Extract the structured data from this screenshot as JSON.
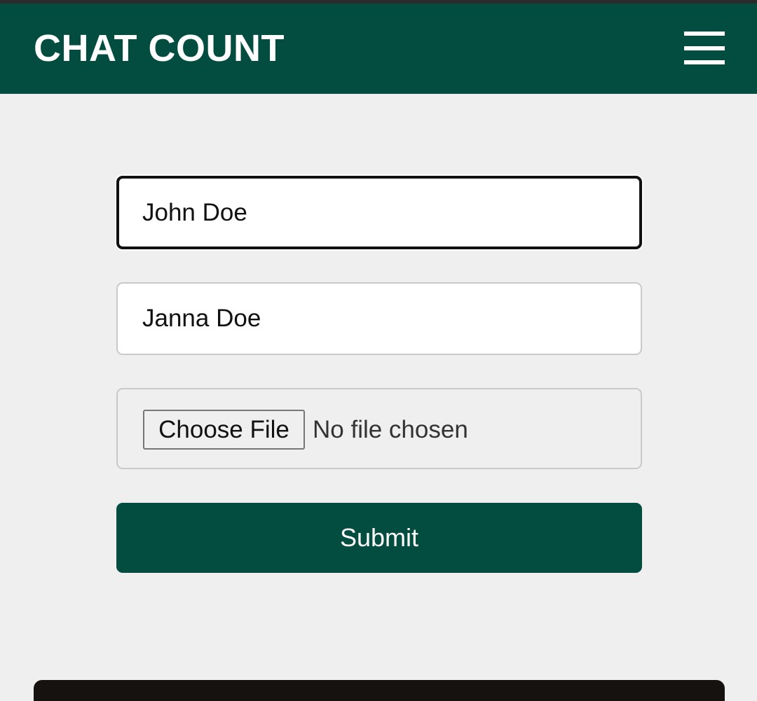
{
  "header": {
    "title": "CHAT COUNT",
    "menu_icon": "hamburger-menu-icon",
    "background_color": "#024d3f"
  },
  "form": {
    "name_one": {
      "value": "John Doe"
    },
    "name_two": {
      "value": "Janna Doe"
    },
    "file_upload": {
      "button_label": "Choose File",
      "status_text": "No file chosen"
    },
    "submit_label": "Submit"
  },
  "colors": {
    "accent": "#024d3f",
    "page_background": "#efefef",
    "footer": "#15120f"
  }
}
